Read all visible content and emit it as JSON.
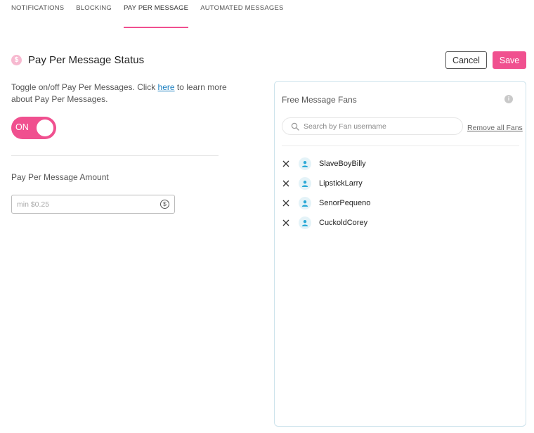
{
  "tabs": [
    {
      "label": "NOTIFICATIONS",
      "active": false
    },
    {
      "label": "BLOCKING",
      "active": false
    },
    {
      "label": "PAY PER MESSAGE",
      "active": true
    },
    {
      "label": "AUTOMATED MESSAGES",
      "active": false
    }
  ],
  "status": {
    "icon": "dollar-coin-icon",
    "icon_glyph": "$",
    "title": "Pay Per Message Status",
    "desc_before": "Toggle on/off Pay Per Messages. Click ",
    "desc_link": "here",
    "desc_after": " to learn more about Pay Per Messages.",
    "toggle_label": "ON",
    "toggle_state": true
  },
  "actions": {
    "cancel_label": "Cancel",
    "save_label": "Save"
  },
  "amount": {
    "label": "Pay Per Message Amount",
    "placeholder": "min $0.25",
    "value": "",
    "icon_glyph": "$"
  },
  "fans_panel": {
    "title": "Free Message Fans",
    "info_glyph": "i",
    "search_placeholder": "Search by Fan username",
    "remove_all_label": "Remove all Fans",
    "fans": [
      {
        "name": "SlaveBoyBilly"
      },
      {
        "name": "LipstickLarry"
      },
      {
        "name": "SenorPequeno"
      },
      {
        "name": "CuckoldCorey"
      }
    ]
  },
  "colors": {
    "accent": "#f0508f",
    "accent_light": "#f7b9d0",
    "link": "#1b7fc0",
    "avatar_icon": "#2ba9d6",
    "panel_border": "#cde3ec"
  }
}
